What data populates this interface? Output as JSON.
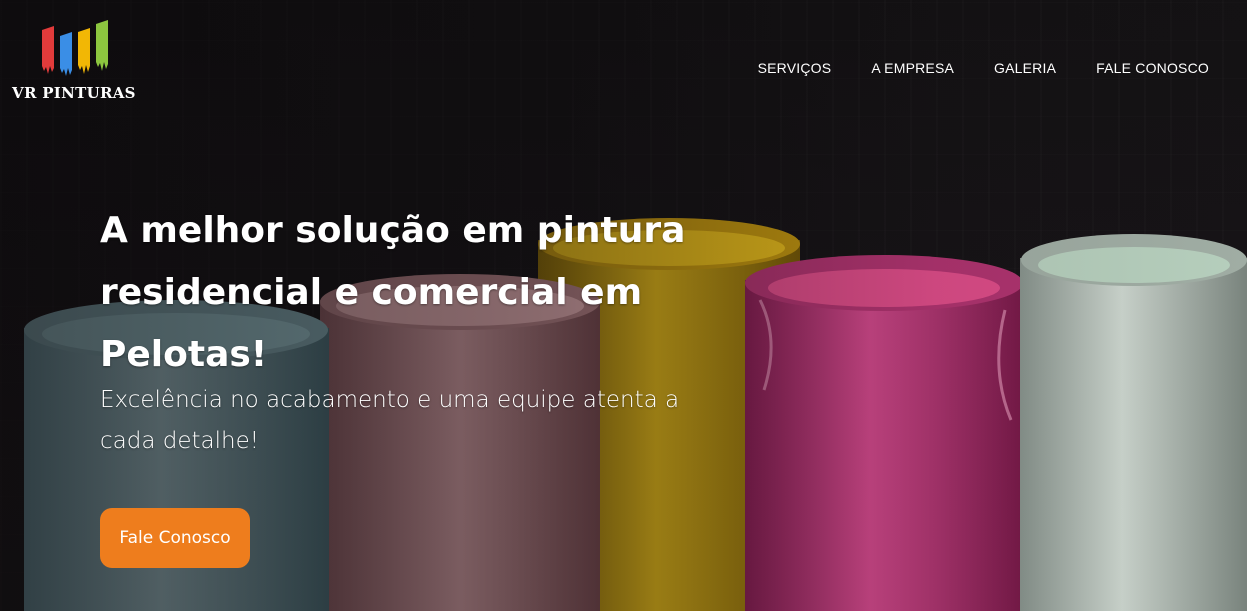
{
  "brand": {
    "name": "VR PINTURAS",
    "logo_bar_colors": [
      "#e23b3b",
      "#3a8ee6",
      "#f2b705",
      "#8cc63f"
    ]
  },
  "nav": {
    "items": [
      {
        "label": "SERVIÇOS"
      },
      {
        "label": "A EMPRESA"
      },
      {
        "label": "GALERIA"
      },
      {
        "label": "FALE CONOSCO"
      }
    ]
  },
  "hero": {
    "title": "A melhor solução em pintura residencial e comercial em Pelotas!",
    "subtitle": "Excelência no acabamento e uma equipe atenta a cada detalhe!",
    "cta_label": "Fale Conosco",
    "cta_color": "#ee7d1d",
    "background_image": "paint-cans-photo",
    "paint_colors": [
      "#8fb8c0",
      "#d49aa0",
      "#e0b417",
      "#d63c86",
      "#c8d8cc"
    ]
  }
}
